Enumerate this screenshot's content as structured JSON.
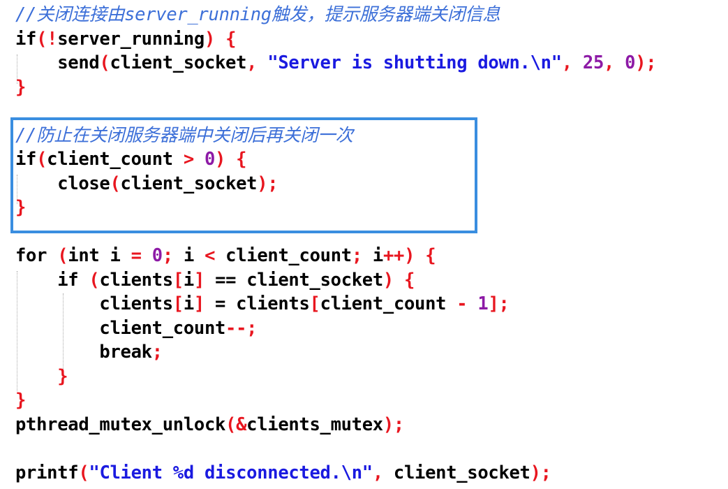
{
  "colors": {
    "comment": "#3c6fd8",
    "keyword": "#000000",
    "operator": "#e8161f",
    "identifier": "#000000",
    "string": "#1a1ae0",
    "number": "#8d1aa6",
    "highlight_border": "#3a8ee0",
    "background": "#ffffff"
  },
  "code_lines": [
    [
      {
        "t": "comment",
        "v": "//关闭连接由server_running触发，提示服务器端关闭信息"
      }
    ],
    [
      {
        "t": "keyword",
        "v": "if"
      },
      {
        "t": "punct",
        "v": "(!"
      },
      {
        "t": "ident",
        "v": "server_running"
      },
      {
        "t": "punct",
        "v": ")"
      },
      {
        "t": "ident",
        "v": " "
      },
      {
        "t": "punct",
        "v": "{"
      }
    ],
    [
      {
        "t": "ident",
        "v": "    send"
      },
      {
        "t": "punct",
        "v": "("
      },
      {
        "t": "ident",
        "v": "client_socket"
      },
      {
        "t": "punct",
        "v": ","
      },
      {
        "t": "ident",
        "v": " "
      },
      {
        "t": "string",
        "v": "\"Server is shutting down.\\n\""
      },
      {
        "t": "punct",
        "v": ","
      },
      {
        "t": "ident",
        "v": " "
      },
      {
        "t": "number",
        "v": "25"
      },
      {
        "t": "punct",
        "v": ","
      },
      {
        "t": "ident",
        "v": " "
      },
      {
        "t": "number",
        "v": "0"
      },
      {
        "t": "punct",
        "v": ");"
      }
    ],
    [
      {
        "t": "punct",
        "v": "}"
      }
    ],
    [],
    [
      {
        "t": "comment",
        "v": "//防止在关闭服务器端中关闭后再关闭一次"
      }
    ],
    [
      {
        "t": "keyword",
        "v": "if"
      },
      {
        "t": "punct",
        "v": "("
      },
      {
        "t": "ident",
        "v": "client_count "
      },
      {
        "t": "punct",
        "v": ">"
      },
      {
        "t": "ident",
        "v": " "
      },
      {
        "t": "number",
        "v": "0"
      },
      {
        "t": "punct",
        "v": ")"
      },
      {
        "t": "ident",
        "v": " "
      },
      {
        "t": "punct",
        "v": "{"
      }
    ],
    [
      {
        "t": "ident",
        "v": "    close"
      },
      {
        "t": "punct",
        "v": "("
      },
      {
        "t": "ident",
        "v": "client_socket"
      },
      {
        "t": "punct",
        "v": ");"
      }
    ],
    [
      {
        "t": "punct",
        "v": "}"
      }
    ],
    [],
    [
      {
        "t": "keyword",
        "v": "for"
      },
      {
        "t": "ident",
        "v": " "
      },
      {
        "t": "punct",
        "v": "("
      },
      {
        "t": "keyword",
        "v": "int"
      },
      {
        "t": "ident",
        "v": " i "
      },
      {
        "t": "punct",
        "v": "="
      },
      {
        "t": "ident",
        "v": " "
      },
      {
        "t": "number",
        "v": "0"
      },
      {
        "t": "punct",
        "v": ";"
      },
      {
        "t": "ident",
        "v": " i "
      },
      {
        "t": "punct",
        "v": "<"
      },
      {
        "t": "ident",
        "v": " client_count"
      },
      {
        "t": "punct",
        "v": ";"
      },
      {
        "t": "ident",
        "v": " i"
      },
      {
        "t": "punct",
        "v": "++)"
      },
      {
        "t": "ident",
        "v": " "
      },
      {
        "t": "punct",
        "v": "{"
      }
    ],
    [
      {
        "t": "keyword",
        "v": "    if"
      },
      {
        "t": "ident",
        "v": " "
      },
      {
        "t": "punct",
        "v": "("
      },
      {
        "t": "ident",
        "v": "clients"
      },
      {
        "t": "punct",
        "v": "["
      },
      {
        "t": "ident",
        "v": "i"
      },
      {
        "t": "punct",
        "v": "]"
      },
      {
        "t": "ident",
        "v": " == client_socket"
      },
      {
        "t": "punct",
        "v": ")"
      },
      {
        "t": "ident",
        "v": " "
      },
      {
        "t": "punct",
        "v": "{"
      }
    ],
    [
      {
        "t": "ident",
        "v": "        clients"
      },
      {
        "t": "punct",
        "v": "["
      },
      {
        "t": "ident",
        "v": "i"
      },
      {
        "t": "punct",
        "v": "]"
      },
      {
        "t": "ident",
        "v": " = clients"
      },
      {
        "t": "punct",
        "v": "["
      },
      {
        "t": "ident",
        "v": "client_count "
      },
      {
        "t": "punct",
        "v": "-"
      },
      {
        "t": "ident",
        "v": " "
      },
      {
        "t": "number",
        "v": "1"
      },
      {
        "t": "punct",
        "v": "];"
      }
    ],
    [
      {
        "t": "ident",
        "v": "        client_count"
      },
      {
        "t": "punct",
        "v": "--;"
      }
    ],
    [
      {
        "t": "keyword",
        "v": "        break"
      },
      {
        "t": "punct",
        "v": ";"
      }
    ],
    [
      {
        "t": "punct",
        "v": "    }"
      }
    ],
    [
      {
        "t": "punct",
        "v": "}"
      }
    ],
    [
      {
        "t": "ident",
        "v": "pthread_mutex_unlock"
      },
      {
        "t": "punct",
        "v": "(&"
      },
      {
        "t": "ident",
        "v": "clients_mutex"
      },
      {
        "t": "punct",
        "v": ");"
      }
    ],
    [],
    [
      {
        "t": "ident",
        "v": "printf"
      },
      {
        "t": "punct",
        "v": "("
      },
      {
        "t": "string",
        "v": "\"Client %d disconnected.\\n\""
      },
      {
        "t": "punct",
        "v": ","
      },
      {
        "t": "ident",
        "v": " client_socket"
      },
      {
        "t": "punct",
        "v": ");"
      }
    ]
  ]
}
